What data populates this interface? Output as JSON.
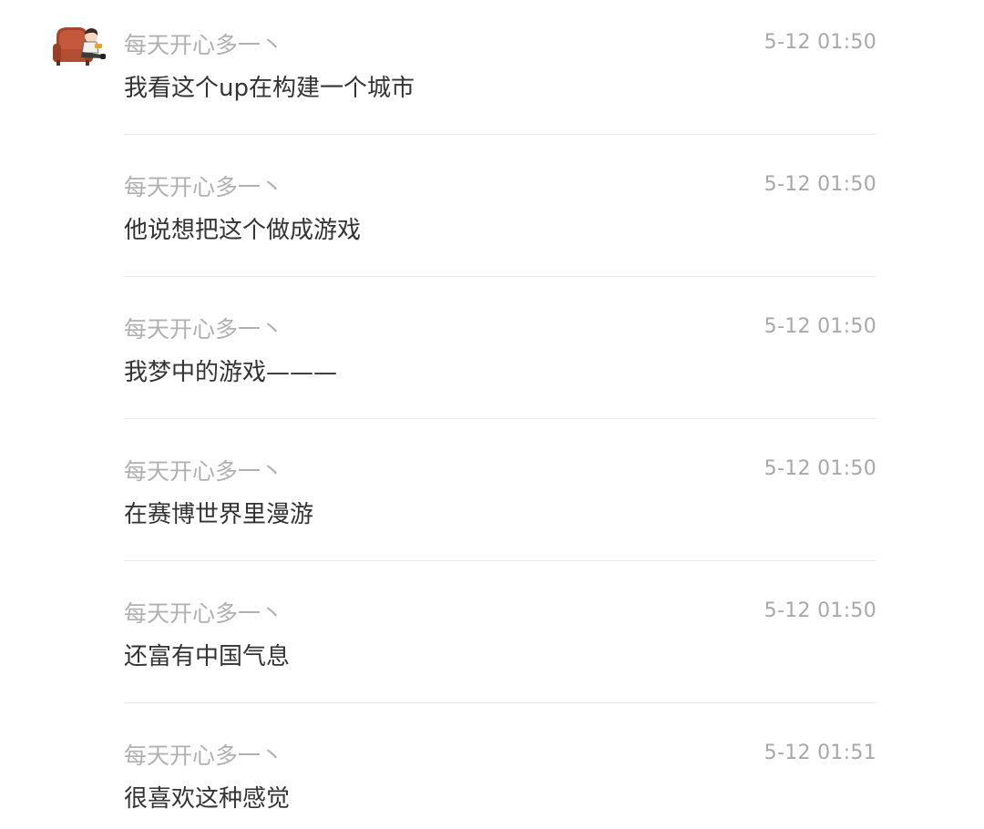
{
  "comments": [
    {
      "author": "每天开心多一丶",
      "time": "5-12 01:50",
      "text": "我看这个up在构建一个城市"
    },
    {
      "author": "每天开心多一丶",
      "time": "5-12 01:50",
      "text": "他说想把这个做成游戏"
    },
    {
      "author": "每天开心多一丶",
      "time": "5-12 01:50",
      "text": "我梦中的游戏———"
    },
    {
      "author": "每天开心多一丶",
      "time": "5-12 01:50",
      "text": "在赛博世界里漫游"
    },
    {
      "author": "每天开心多一丶",
      "time": "5-12 01:50",
      "text": "还富有中国气息"
    },
    {
      "author": "每天开心多一丶",
      "time": "5-12 01:51",
      "text": "很喜欢这种感觉"
    }
  ],
  "avatar_icon": "cartoon-person-in-armchair-icon"
}
